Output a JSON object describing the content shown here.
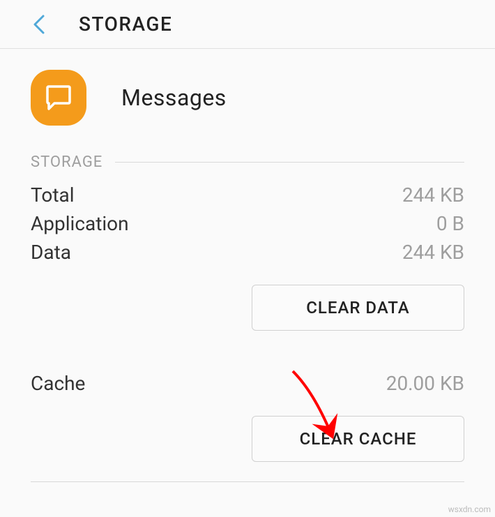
{
  "header": {
    "title": "STORAGE"
  },
  "app": {
    "name": "Messages"
  },
  "section": {
    "title": "STORAGE"
  },
  "storage": {
    "total": {
      "label": "Total",
      "value": "244 KB"
    },
    "application": {
      "label": "Application",
      "value": "0 B"
    },
    "data": {
      "label": "Data",
      "value": "244 KB"
    },
    "cache": {
      "label": "Cache",
      "value": "20.00 KB"
    }
  },
  "buttons": {
    "clear_data": "CLEAR DATA",
    "clear_cache": "CLEAR CACHE"
  },
  "watermark": "wsxdn.com"
}
